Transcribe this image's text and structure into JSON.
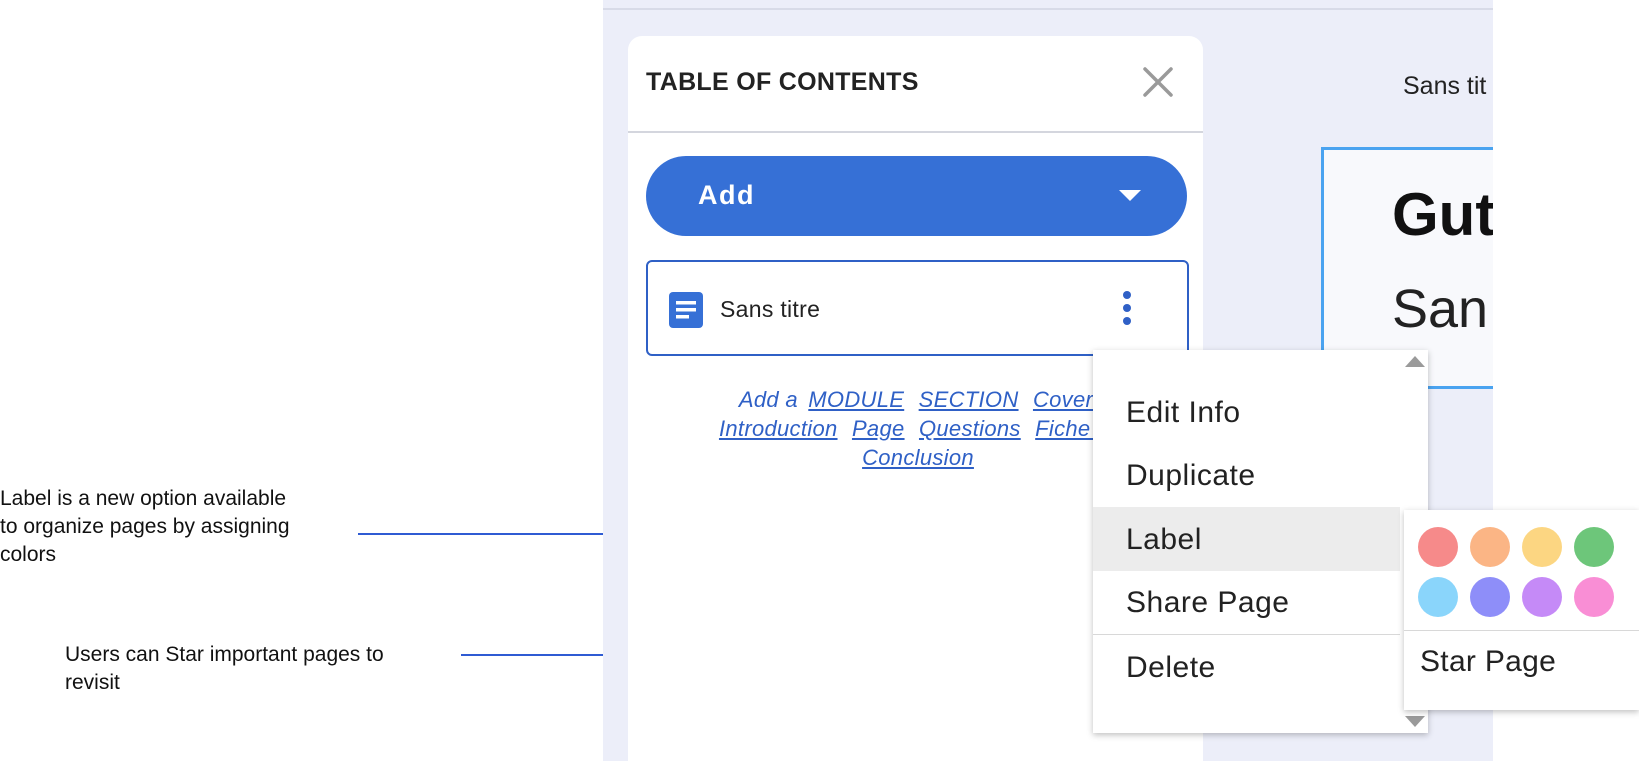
{
  "annotations": {
    "label_note": [
      "Label is a new option available",
      "to organize pages by assigning",
      "colors"
    ],
    "star_note": [
      "Users can Star important pages to",
      "revisit"
    ]
  },
  "toc": {
    "title": "TABLE OF CONTENTS",
    "add_button": "Add",
    "page": {
      "label": "Sans titre",
      "icon": "document-icon"
    },
    "add_prefix": "Add a",
    "add_links": [
      "MODULE",
      "SECTION",
      "Cover",
      "Introduction",
      "Page",
      "Questions",
      "Fiche re",
      "Conclusion"
    ]
  },
  "canvas": {
    "caption": "Sans tit",
    "heading": "Gut",
    "subheading": "San"
  },
  "context_menu": {
    "items": [
      "Edit Info",
      "Duplicate",
      "Label",
      "Share Page",
      "Delete"
    ],
    "active_item": "Label"
  },
  "label_submenu": {
    "colors": [
      "#f68a8a",
      "#fbb585",
      "#fcd682",
      "#6dc67a",
      "#8ad5fb",
      "#8e8ef9",
      "#c58af7",
      "#f98ed5"
    ],
    "star_label": "Star Page"
  },
  "theme": {
    "accent": "#3670d6",
    "selection_border": "#4aa3f0",
    "app_background": "#eceef9"
  }
}
